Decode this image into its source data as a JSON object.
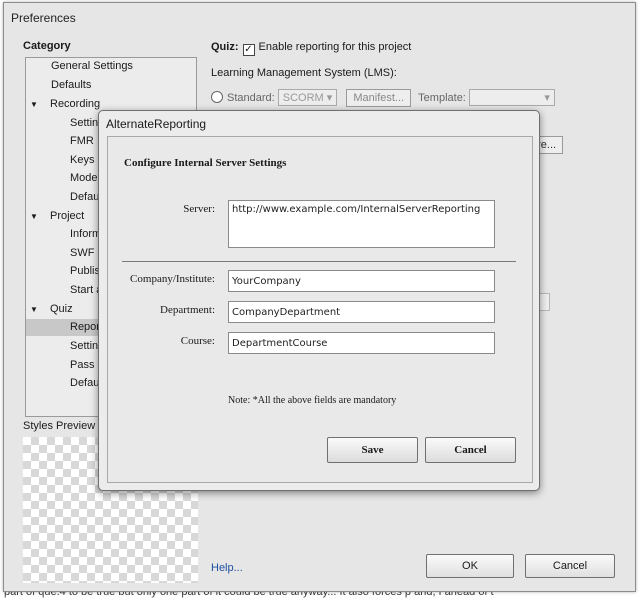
{
  "background": {
    "footer_text": "part of que.4 to be true but only one part of it could be true anyway... It also forces p and, I ahead of t"
  },
  "preferences": {
    "title": "Preferences",
    "category_label": "Category",
    "tree": [
      "General Settings",
      "Defaults",
      "Recording",
      "Settings",
      "FMR",
      "Keys",
      "Modes",
      "Defaults",
      "Project",
      "Information",
      "SWF Size",
      "Publish",
      "Start and End",
      "Quiz",
      "Reporting",
      "Settings",
      "Pass or Fail",
      "Default Labels"
    ],
    "tree_visible": [
      "General Settings",
      "Defaults",
      "Recording",
      "Settin",
      "FMR",
      "Keys",
      "Mode",
      "Defau",
      "Project",
      "Inform",
      "SWF S",
      "Publis",
      "Start a",
      "Quiz",
      "Repor",
      "Settin",
      "Pass o",
      "Defau"
    ],
    "styles_preview_label": "Styles Preview",
    "quiz_label": "Quiz:",
    "enable_reporting_label": "Enable reporting for this project",
    "enable_reporting_checked": true,
    "lms_label": "Learning Management System (LMS):",
    "standard_label": "Standard:",
    "standard_value": "SCORM",
    "manifest_button": "Manifest...",
    "template_label": "Template:",
    "configure_button_partial": "are...",
    "help_link": "Help...",
    "ok_button": "OK",
    "cancel_button": "Cancel"
  },
  "modal": {
    "title": "AlternateReporting",
    "heading": "Configure Internal Server Settings",
    "server_label": "Server:",
    "server_value": "http://www.example.com/InternalServerReporting",
    "company_label": "Company/Institute:",
    "company_value": "YourCompany",
    "department_label": "Department:",
    "department_value": "CompanyDepartment",
    "course_label": "Course:",
    "course_value": "DepartmentCourse",
    "note": "Note: *All the above fields are mandatory",
    "save_button": "Save",
    "cancel_button": "Cancel"
  }
}
